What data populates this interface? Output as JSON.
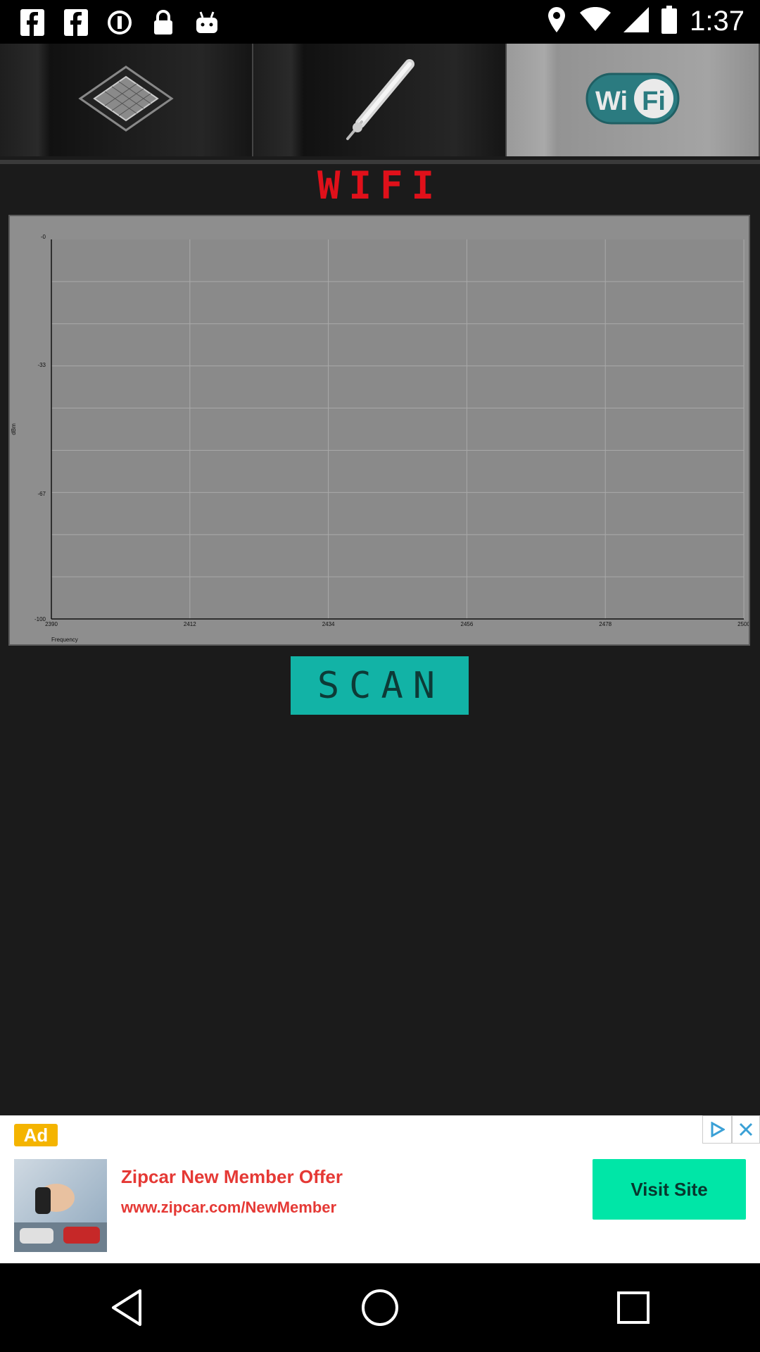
{
  "status_bar": {
    "time": "1:37",
    "left_icons": [
      "facebook-icon",
      "facebook-icon",
      "info-icon",
      "lock-icon",
      "android-icon"
    ],
    "right_icons": [
      "location-icon",
      "wifi-signal-icon",
      "cell-signal-icon",
      "battery-icon"
    ]
  },
  "tabs": [
    {
      "name": "cpu-tab",
      "icon": "cpu-chip-icon",
      "active": false
    },
    {
      "name": "temperature-tab",
      "icon": "thermometer-icon",
      "active": false
    },
    {
      "name": "wifi-tab",
      "icon": "wifi-logo-icon",
      "label": "Wi Fi",
      "active": true
    }
  ],
  "page_title": "WIFI",
  "chart_data": {
    "type": "line",
    "xlabel": "Frequency",
    "ylabel": "dBm",
    "x_ticks": [
      "2390",
      "2412",
      "2434",
      "2456",
      "2478",
      "2500"
    ],
    "y_ticks": [
      "-0",
      "-33",
      "-67",
      "-100"
    ],
    "xlim": [
      2390,
      2500
    ],
    "ylim": [
      -100,
      0
    ],
    "series": [],
    "grid": true,
    "colors": {
      "plot_bg": "#8e8e8e",
      "grid": "#a9a9a9",
      "axis": "#111111"
    }
  },
  "scan_button": {
    "label": "SCAN",
    "color": "#12b3a6"
  },
  "ad": {
    "badge": "Ad",
    "title": "Zipcar New Member Offer",
    "url": "www.zipcar.com/NewMember",
    "cta": "Visit Site"
  },
  "nav": [
    "back-icon",
    "home-icon",
    "recents-icon"
  ]
}
